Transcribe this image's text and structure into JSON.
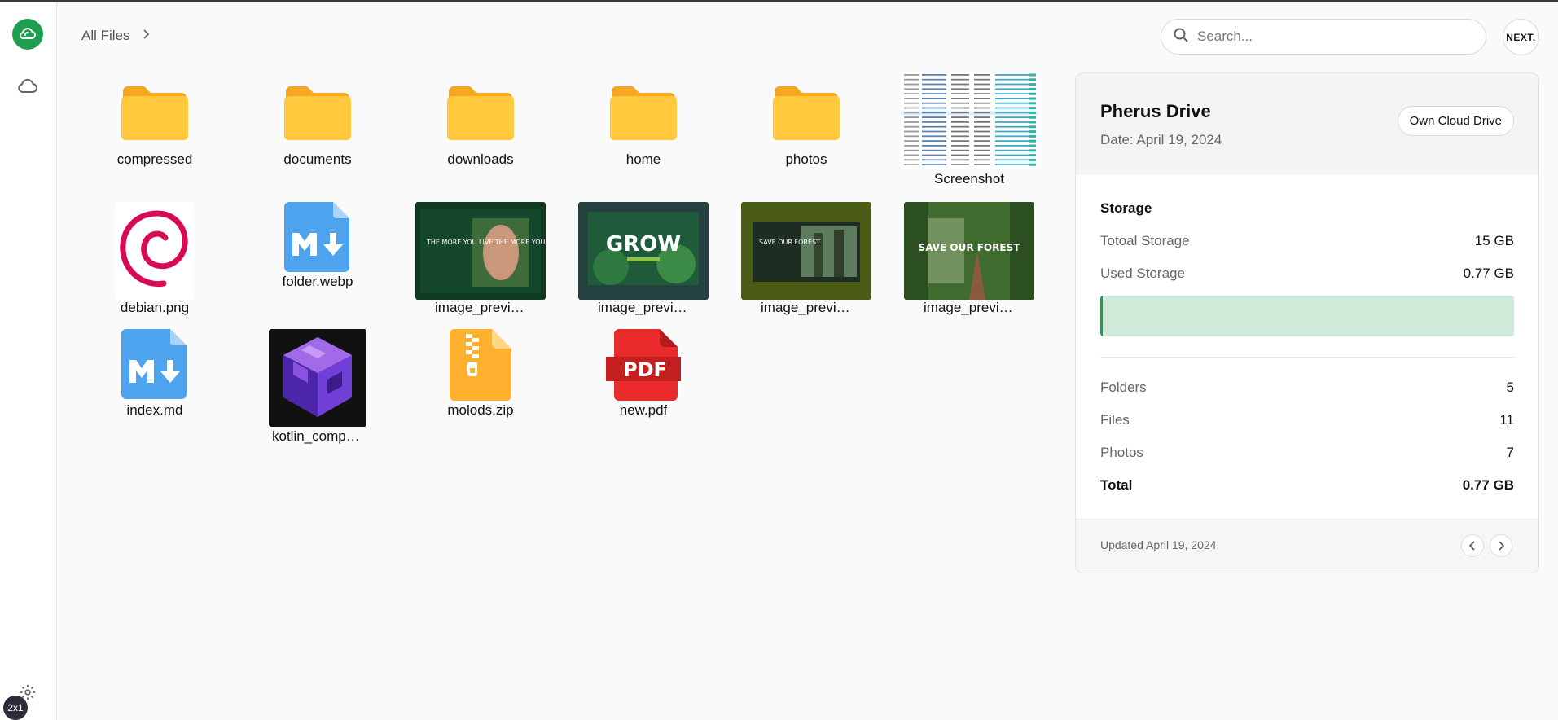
{
  "sidebar": {
    "logo_icon": "cloud-logo-icon",
    "nav_icon": "cloud-icon",
    "settings_icon": "gear-icon",
    "zoom_badge": "2x1",
    "accent": "#1e9e4f"
  },
  "breadcrumb": {
    "label": "All Files",
    "icon": "chevron-right-icon"
  },
  "search": {
    "placeholder": "Search..."
  },
  "avatar": {
    "text": "NEXT."
  },
  "files": [
    {
      "name": "compressed",
      "kind": "folder"
    },
    {
      "name": "documents",
      "kind": "folder"
    },
    {
      "name": "downloads",
      "kind": "folder"
    },
    {
      "name": "home",
      "kind": "folder"
    },
    {
      "name": "photos",
      "kind": "folder"
    },
    {
      "name": "Screenshot",
      "kind": "screenshot"
    },
    {
      "name": "debian.png",
      "kind": "debian"
    },
    {
      "name": "folder.webp",
      "kind": "markdown"
    },
    {
      "name": "image_preview",
      "kind": "image"
    },
    {
      "name": "image_preview",
      "kind": "image"
    },
    {
      "name": "image_preview",
      "kind": "image"
    },
    {
      "name": "image_preview",
      "kind": "image"
    },
    {
      "name": "index.md",
      "kind": "markdown"
    },
    {
      "name": "kotlin_compose",
      "kind": "cube"
    },
    {
      "name": "molods.zip",
      "kind": "zip"
    },
    {
      "name": "new.pdf",
      "kind": "pdf",
      "badge": "PDF"
    }
  ],
  "image_thumbs": [
    {
      "text": "THE MORE YOU LIVE THE MORE YOU"
    },
    {
      "text": "GROW"
    },
    {
      "text": "SAVE OUR FOREST"
    },
    {
      "text": "SAVE OUR FOREST"
    }
  ],
  "panel": {
    "title": "Pherus Drive",
    "date": "Date: April 19, 2024",
    "button": "Own Cloud Drive",
    "storage_title": "Storage",
    "total_label": "Totoal Storage",
    "total_value": "15 GB",
    "used_label": "Used Storage",
    "used_value": "0.77 GB",
    "used_fraction": 0.0051,
    "stats": [
      {
        "label": "Folders",
        "value": "5"
      },
      {
        "label": "Files",
        "value": "11"
      },
      {
        "label": "Photos",
        "value": "7"
      },
      {
        "label": "Total",
        "value": "0.77 GB"
      }
    ],
    "updated": "Updated April 19, 2024",
    "prev_icon": "chevron-left-icon",
    "next_icon": "chevron-right-icon"
  }
}
